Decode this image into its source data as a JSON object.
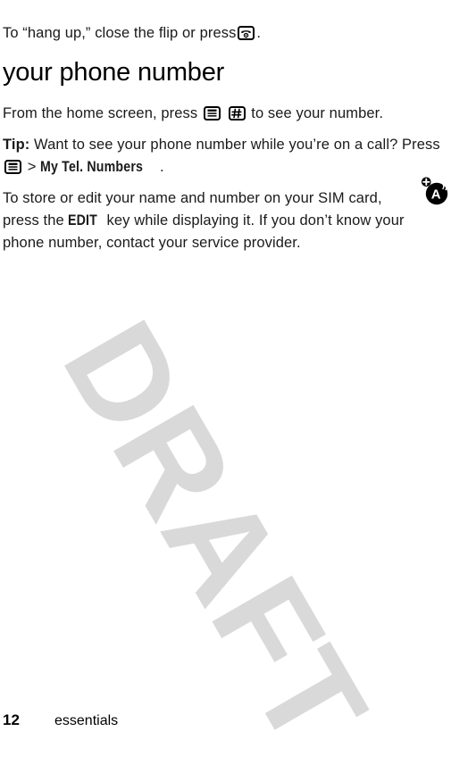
{
  "document": {
    "type": "user-guide-page",
    "watermark": "DRAFT",
    "watermark_color": "#d9d9d9"
  },
  "body": {
    "intro_paragraph": {
      "before_icon": "To “hang up,” close the flip or press",
      "icon": "end-call-key-icon",
      "after_icon": "."
    },
    "heading": "your phone number",
    "home_screen_paragraph": {
      "before_icons": "From the home screen, press",
      "icon_1": "menu-key-icon",
      "icon_2": "pound-key-icon",
      "after_icons": "to see your number."
    },
    "tip_paragraph": {
      "label": "Tip:",
      "text_1": "Want to see your phone number while you’re on a call? Press",
      "icon": "menu-key-icon",
      "separator": ">",
      "menu_path": "My Tel. Numbers",
      "text_2": "."
    },
    "sim_paragraph": {
      "text_1": "To store or edit your name and number on your SIM card, press the",
      "softkey": "EDIT",
      "text_2": "key while displaying it. If you don’t know your phone number, contact your service provider."
    },
    "margin_icon": "network-feature-icon"
  },
  "footer": {
    "page_number": "12",
    "section_name": "essentials"
  }
}
